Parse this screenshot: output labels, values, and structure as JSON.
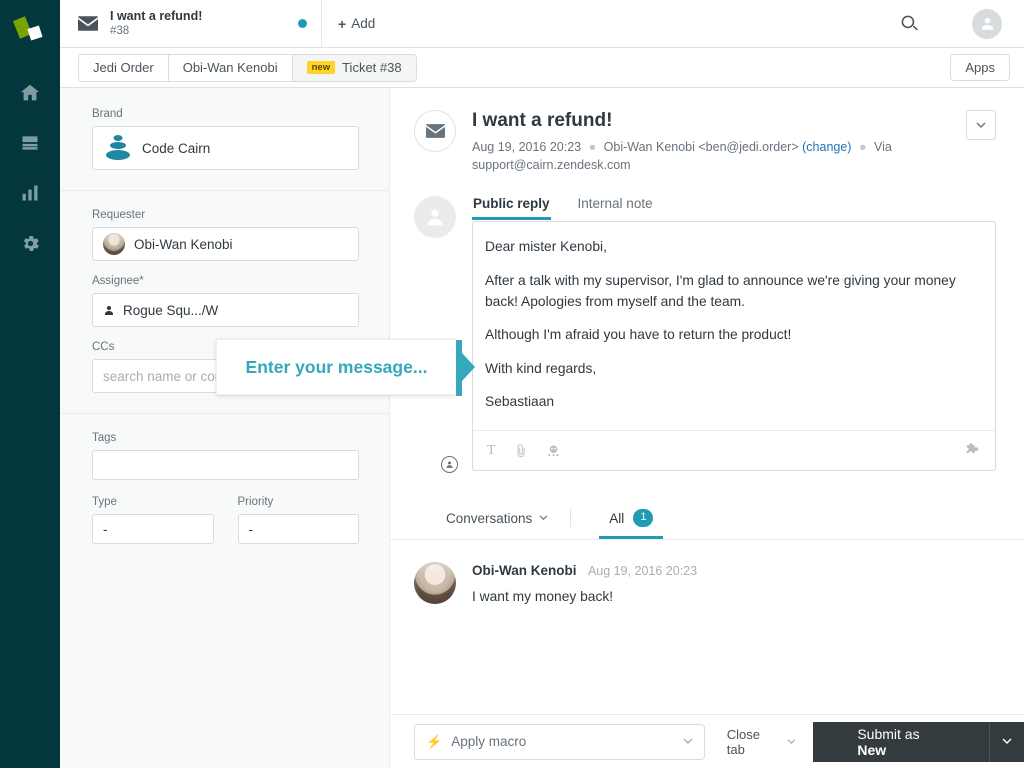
{
  "colors": {
    "rail_bg": "#03363d",
    "accent_teal": "#1f9bb5",
    "callout_teal": "#35a8bd",
    "badge_yellow": "#ffd424",
    "link_blue": "#1f73b7",
    "submit_dark": "#333b3e"
  },
  "rail": {
    "logo": "zendesk-logo",
    "items": [
      {
        "name": "home-icon",
        "label": "Home"
      },
      {
        "name": "views-icon",
        "label": "Views"
      },
      {
        "name": "reporting-icon",
        "label": "Reporting"
      },
      {
        "name": "admin-gear-icon",
        "label": "Admin"
      }
    ]
  },
  "topbar": {
    "ticket_card": {
      "icon": "envelope-icon",
      "title": "I want a refund!",
      "number": "#38",
      "status_dot": "unread-dot"
    },
    "add_label": "Add",
    "add_icon": "plus-icon",
    "icons": [
      {
        "name": "search-icon"
      },
      {
        "name": "apps-grid-icon"
      },
      {
        "name": "user-avatar-icon"
      }
    ]
  },
  "tabstrip": {
    "tabs": [
      {
        "label": "Jedi Order",
        "badge": "",
        "active": false
      },
      {
        "label": "Obi-Wan Kenobi",
        "badge": "",
        "active": false
      },
      {
        "label": "Ticket #38",
        "badge": "new",
        "active": true
      }
    ],
    "apps_button": "Apps"
  },
  "pane": {
    "brand": {
      "label": "Brand",
      "value": "Code Cairn",
      "icon": "cairn-logo-icon"
    },
    "requester": {
      "label": "Requester",
      "value": "Obi-Wan Kenobi",
      "icon": "user-avatar"
    },
    "assignee": {
      "label": "Assignee*",
      "value": "Rogue Squ.../W",
      "icon": "person-icon"
    },
    "ccs": {
      "label": "CCs",
      "value": "",
      "placeholder": "search name or contact info"
    },
    "tags": {
      "label": "Tags",
      "value": ""
    },
    "type": {
      "label": "Type",
      "value": "-"
    },
    "priority": {
      "label": "Priority",
      "value": "-"
    }
  },
  "ticket": {
    "icon": "envelope-icon",
    "title": "I want a refund!",
    "date": "Aug 19, 2016 20:23",
    "requester_line": "Obi-Wan Kenobi <ben@jedi.order>",
    "change_link": "(change)",
    "via_label": "Via",
    "via_value": "support@cairn.zendesk.com",
    "options_icon": "chevron-down-icon"
  },
  "composer": {
    "avatar": "agent-avatar",
    "avatar_badge": "public-reply-badge",
    "tabs": [
      {
        "label": "Public reply",
        "active": true
      },
      {
        "label": "Internal note",
        "active": false
      }
    ],
    "message_paragraphs": [
      "Dear mister Kenobi,",
      "After a talk with my supervisor, I'm glad to announce we're giving your money back! Apologies from myself and the team.",
      "Although I'm afraid you have to return the product!",
      "With kind regards,",
      "Sebastiaan"
    ],
    "toolbar": [
      {
        "name": "text-format-icon",
        "glyph": "T"
      },
      {
        "name": "attachment-paperclip-icon"
      },
      {
        "name": "emoji-icon"
      }
    ],
    "toolbar_right": {
      "name": "apps-puzzle-icon"
    }
  },
  "callout": {
    "text": "Enter your message..."
  },
  "conversations": {
    "selector_label": "Conversations",
    "selector_icon": "chevron-down-icon",
    "all_tab": {
      "label": "All",
      "count": "1"
    },
    "comments": [
      {
        "author": "Obi-Wan Kenobi",
        "date": "Aug 19, 2016 20:23",
        "text": "I want my money back!",
        "avatar": "obiwan-avatar"
      }
    ]
  },
  "footer": {
    "macro": {
      "label": "Apply macro",
      "icon": "bolt-icon",
      "caret": "chevron-down-icon"
    },
    "close_tab": {
      "label": "Close tab",
      "caret": "chevron-down-icon"
    },
    "submit": {
      "prefix": "Submit as ",
      "state": "New",
      "caret": "chevron-down-icon"
    }
  }
}
